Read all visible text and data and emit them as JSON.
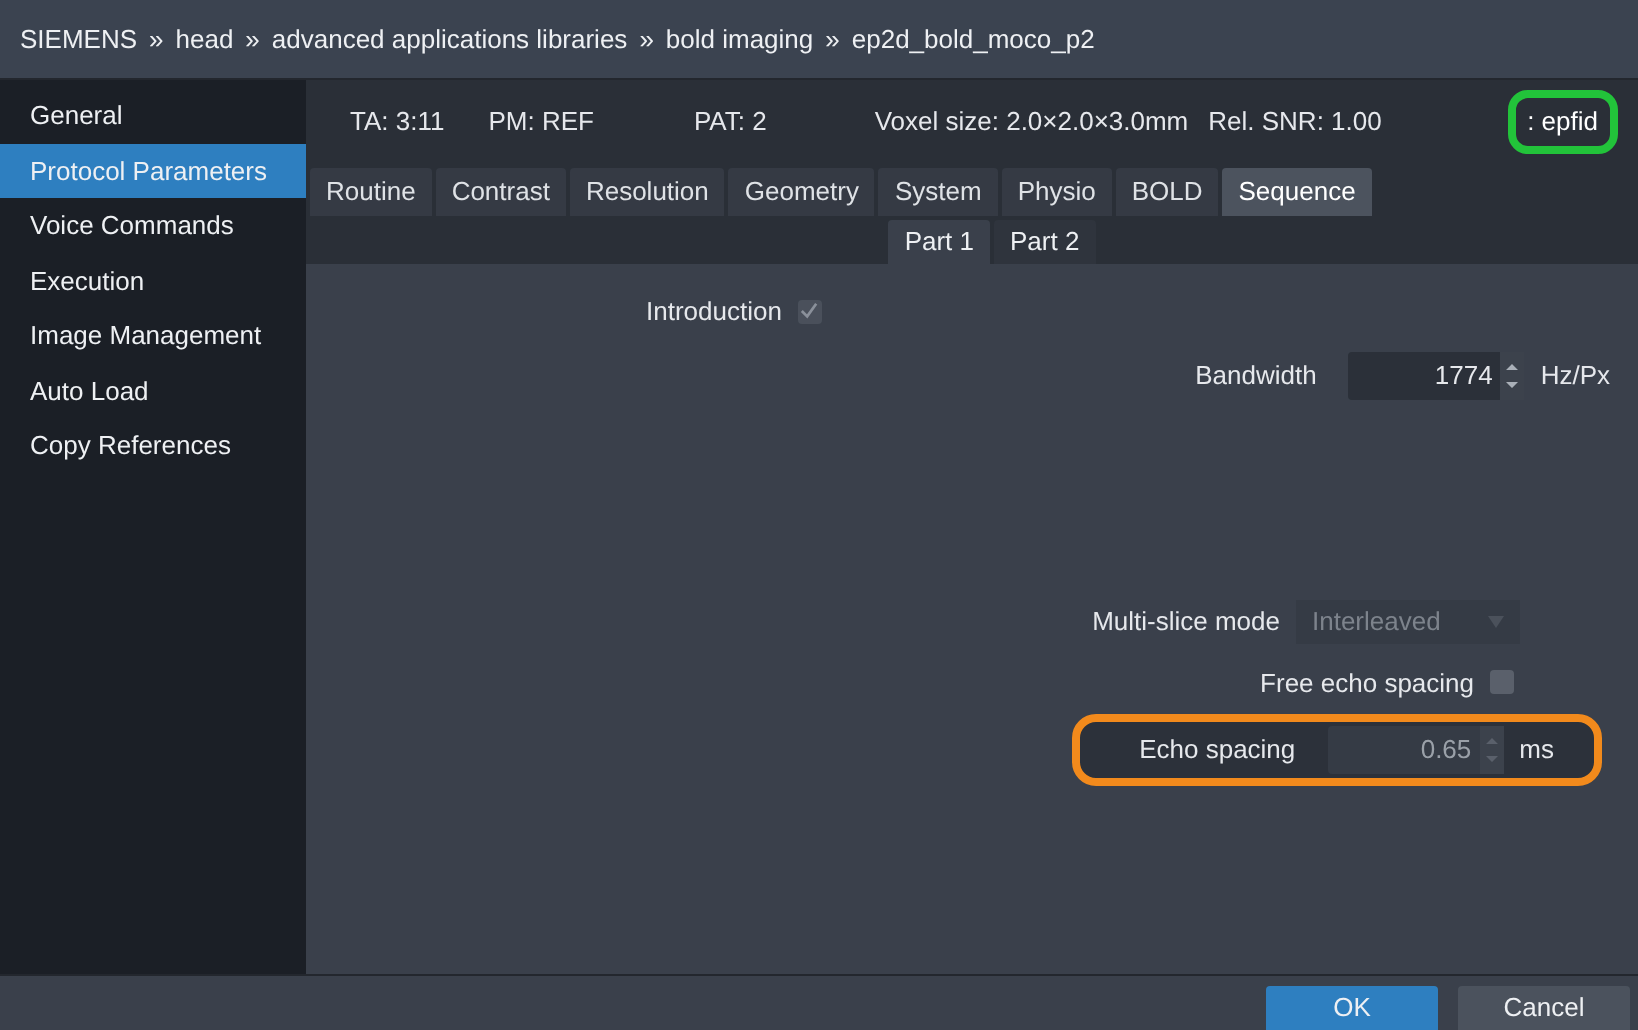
{
  "breadcrumb": {
    "separator": "»",
    "items": [
      "SIEMENS",
      "head",
      "advanced applications libraries",
      "bold imaging",
      "ep2d_bold_moco_p2"
    ]
  },
  "sidebar": {
    "items": [
      {
        "label": "General",
        "selected": false
      },
      {
        "label": "Protocol Parameters",
        "selected": true
      },
      {
        "label": "Voice Commands",
        "selected": false
      },
      {
        "label": "Execution",
        "selected": false
      },
      {
        "label": "Image Management",
        "selected": false
      },
      {
        "label": "Auto Load",
        "selected": false
      },
      {
        "label": "Copy References",
        "selected": false
      }
    ]
  },
  "info_bar": {
    "items": [
      "TA: 3:11",
      "PM: REF",
      "PAT: 2",
      "Voxel size: 2.0×2.0×3.0mm",
      "Rel. SNR: 1.00"
    ],
    "sequence_tag": ": epfid"
  },
  "tabs": [
    {
      "label": "Routine",
      "selected": false
    },
    {
      "label": "Contrast",
      "selected": false
    },
    {
      "label": "Resolution",
      "selected": false
    },
    {
      "label": "Geometry",
      "selected": false
    },
    {
      "label": "System",
      "selected": false
    },
    {
      "label": "Physio",
      "selected": false
    },
    {
      "label": "BOLD",
      "selected": false
    },
    {
      "label": "Sequence",
      "selected": true
    }
  ],
  "subtabs": [
    {
      "label": "Part 1",
      "selected": true
    },
    {
      "label": "Part 2",
      "selected": false
    }
  ],
  "fields": [
    {
      "kind": "checkbox",
      "label": "Introduction",
      "checked": true,
      "disabled": true
    },
    {
      "kind": "spinner",
      "label": "Bandwidth",
      "value": "1774",
      "unit": "Hz/Px",
      "disabled": false
    },
    {
      "kind": "dropdown",
      "label": "Multi-slice mode",
      "value": "Interleaved",
      "disabled": true
    },
    {
      "kind": "checkbox",
      "label": "Free echo spacing",
      "checked": false,
      "disabled": false
    },
    {
      "kind": "spinner",
      "label": "Echo spacing",
      "value": "0.65",
      "unit": "ms",
      "disabled": true,
      "highlighted": true
    }
  ],
  "buttons": [
    {
      "label": "OK",
      "kind": "primary"
    },
    {
      "label": "Cancel",
      "kind": "secondary"
    }
  ]
}
